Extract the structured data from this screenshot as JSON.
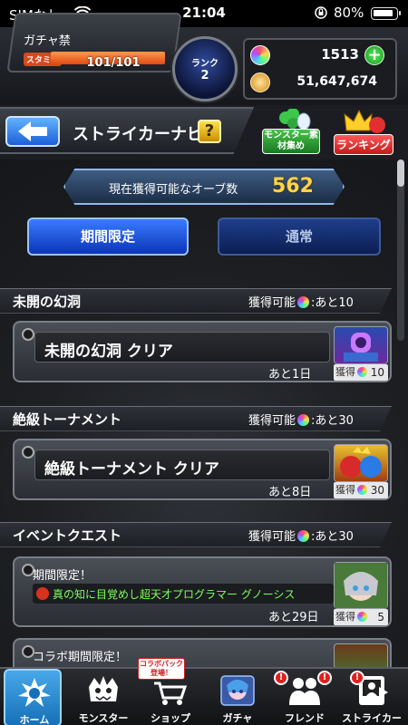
{
  "status_bar": {
    "carrier": "SIMなし",
    "time": "21:04",
    "battery_pct": "80%"
  },
  "header": {
    "gacha_ban": "ガチャ禁",
    "stamina_label": "スタミナ",
    "stamina_value": "101/101",
    "stamina_fraction": 1.0,
    "rank_label": "ランク",
    "rank_value": "2",
    "orbs": "1513",
    "gold": "51,647,674"
  },
  "nav": {
    "title": "ストライカーナビ",
    "help": "?",
    "monster_button": "モンスター素材集め",
    "ranking_button": "ランキング"
  },
  "orb_panel": {
    "label": "現在獲得可能なオーブ数",
    "value": "562"
  },
  "tabs": {
    "limited": "期間限定",
    "normal": "通常"
  },
  "sections": [
    {
      "title": "未開の幻洞",
      "avail_prefix": "獲得可能",
      "avail_suffix": ":あと10",
      "item": {
        "title": "未開の幻洞 クリア",
        "remaining": "あと1日",
        "reward_label": "獲得",
        "reward_value": "10"
      }
    },
    {
      "title": "絶級トーナメント",
      "avail_prefix": "獲得可能",
      "avail_suffix": ":あと30",
      "item": {
        "title": "絶級トーナメント クリア",
        "remaining": "あと8日",
        "reward_label": "獲得",
        "reward_value": "30"
      }
    },
    {
      "title": "イベントクエスト",
      "avail_prefix": "獲得可能",
      "avail_suffix": ":あと30",
      "item": {
        "subtitle": "期間限定！",
        "title": "真の知に目覚めし超天才プログラマー グノーシス",
        "remaining": "あと29日",
        "reward_label": "獲得",
        "reward_value": "5"
      },
      "item2": {
        "subtitle": "コラボ期間限定！"
      }
    }
  ],
  "bottom_nav": {
    "home": "ホーム",
    "monster": "モンスター",
    "shop": "ショップ",
    "gacha": "ガチャ",
    "friend": "フレンド",
    "striker": "ストライカー",
    "collab_badge": "コラボパック登場！"
  },
  "colors": {
    "accent_blue": "#1b5fd9",
    "orb_value": "#ffd44a",
    "event_title": "#7cff5a",
    "stamina": "#e04a14"
  }
}
